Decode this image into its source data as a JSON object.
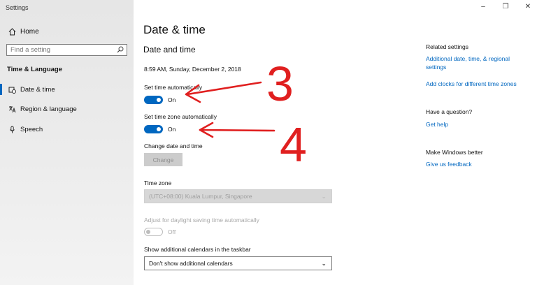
{
  "window": {
    "app_title": "Settings",
    "controls": {
      "minimize": "–",
      "restore": "❐",
      "close": "✕"
    }
  },
  "sidebar": {
    "home_label": "Home",
    "search_placeholder": "Find a setting",
    "section_header": "Time & Language",
    "items": [
      {
        "label": "Date & time",
        "selected": true,
        "icon": "calendar-clock-icon"
      },
      {
        "label": "Region & language",
        "selected": false,
        "icon": "region-language-icon"
      },
      {
        "label": "Speech",
        "selected": false,
        "icon": "microphone-icon"
      }
    ]
  },
  "main": {
    "page_title": "Date & time",
    "section_title": "Date and time",
    "current_datetime": "8:59 AM, Sunday, December 2, 2018",
    "set_time_auto": {
      "label": "Set time automatically",
      "state": "On"
    },
    "set_timezone_auto": {
      "label": "Set time zone automatically",
      "state": "On"
    },
    "change_datetime": {
      "label": "Change date and time",
      "button": "Change"
    },
    "time_zone": {
      "label": "Time zone",
      "value": "(UTC+08:00) Kuala Lumpur, Singapore"
    },
    "daylight": {
      "label": "Adjust for daylight saving time automatically",
      "state": "Off"
    },
    "calendars": {
      "label": "Show additional calendars in the taskbar",
      "value": "Don't show additional calendars"
    }
  },
  "related": {
    "heading": "Related settings",
    "link1_line1": "Additional date, time, & regional",
    "link1_line2": "settings",
    "link2": "Add clocks for different time zones",
    "question_heading": "Have a question?",
    "help_link": "Get help",
    "better_heading": "Make Windows better",
    "feedback_link": "Give us feedback"
  },
  "annotations": {
    "marker_a": "3",
    "marker_b": "4",
    "color": "#e01f1f"
  },
  "colors": {
    "accent": "#0067c0",
    "sidebar_bg": "#e6e6e6",
    "disabled_text": "#a8a8a8"
  }
}
